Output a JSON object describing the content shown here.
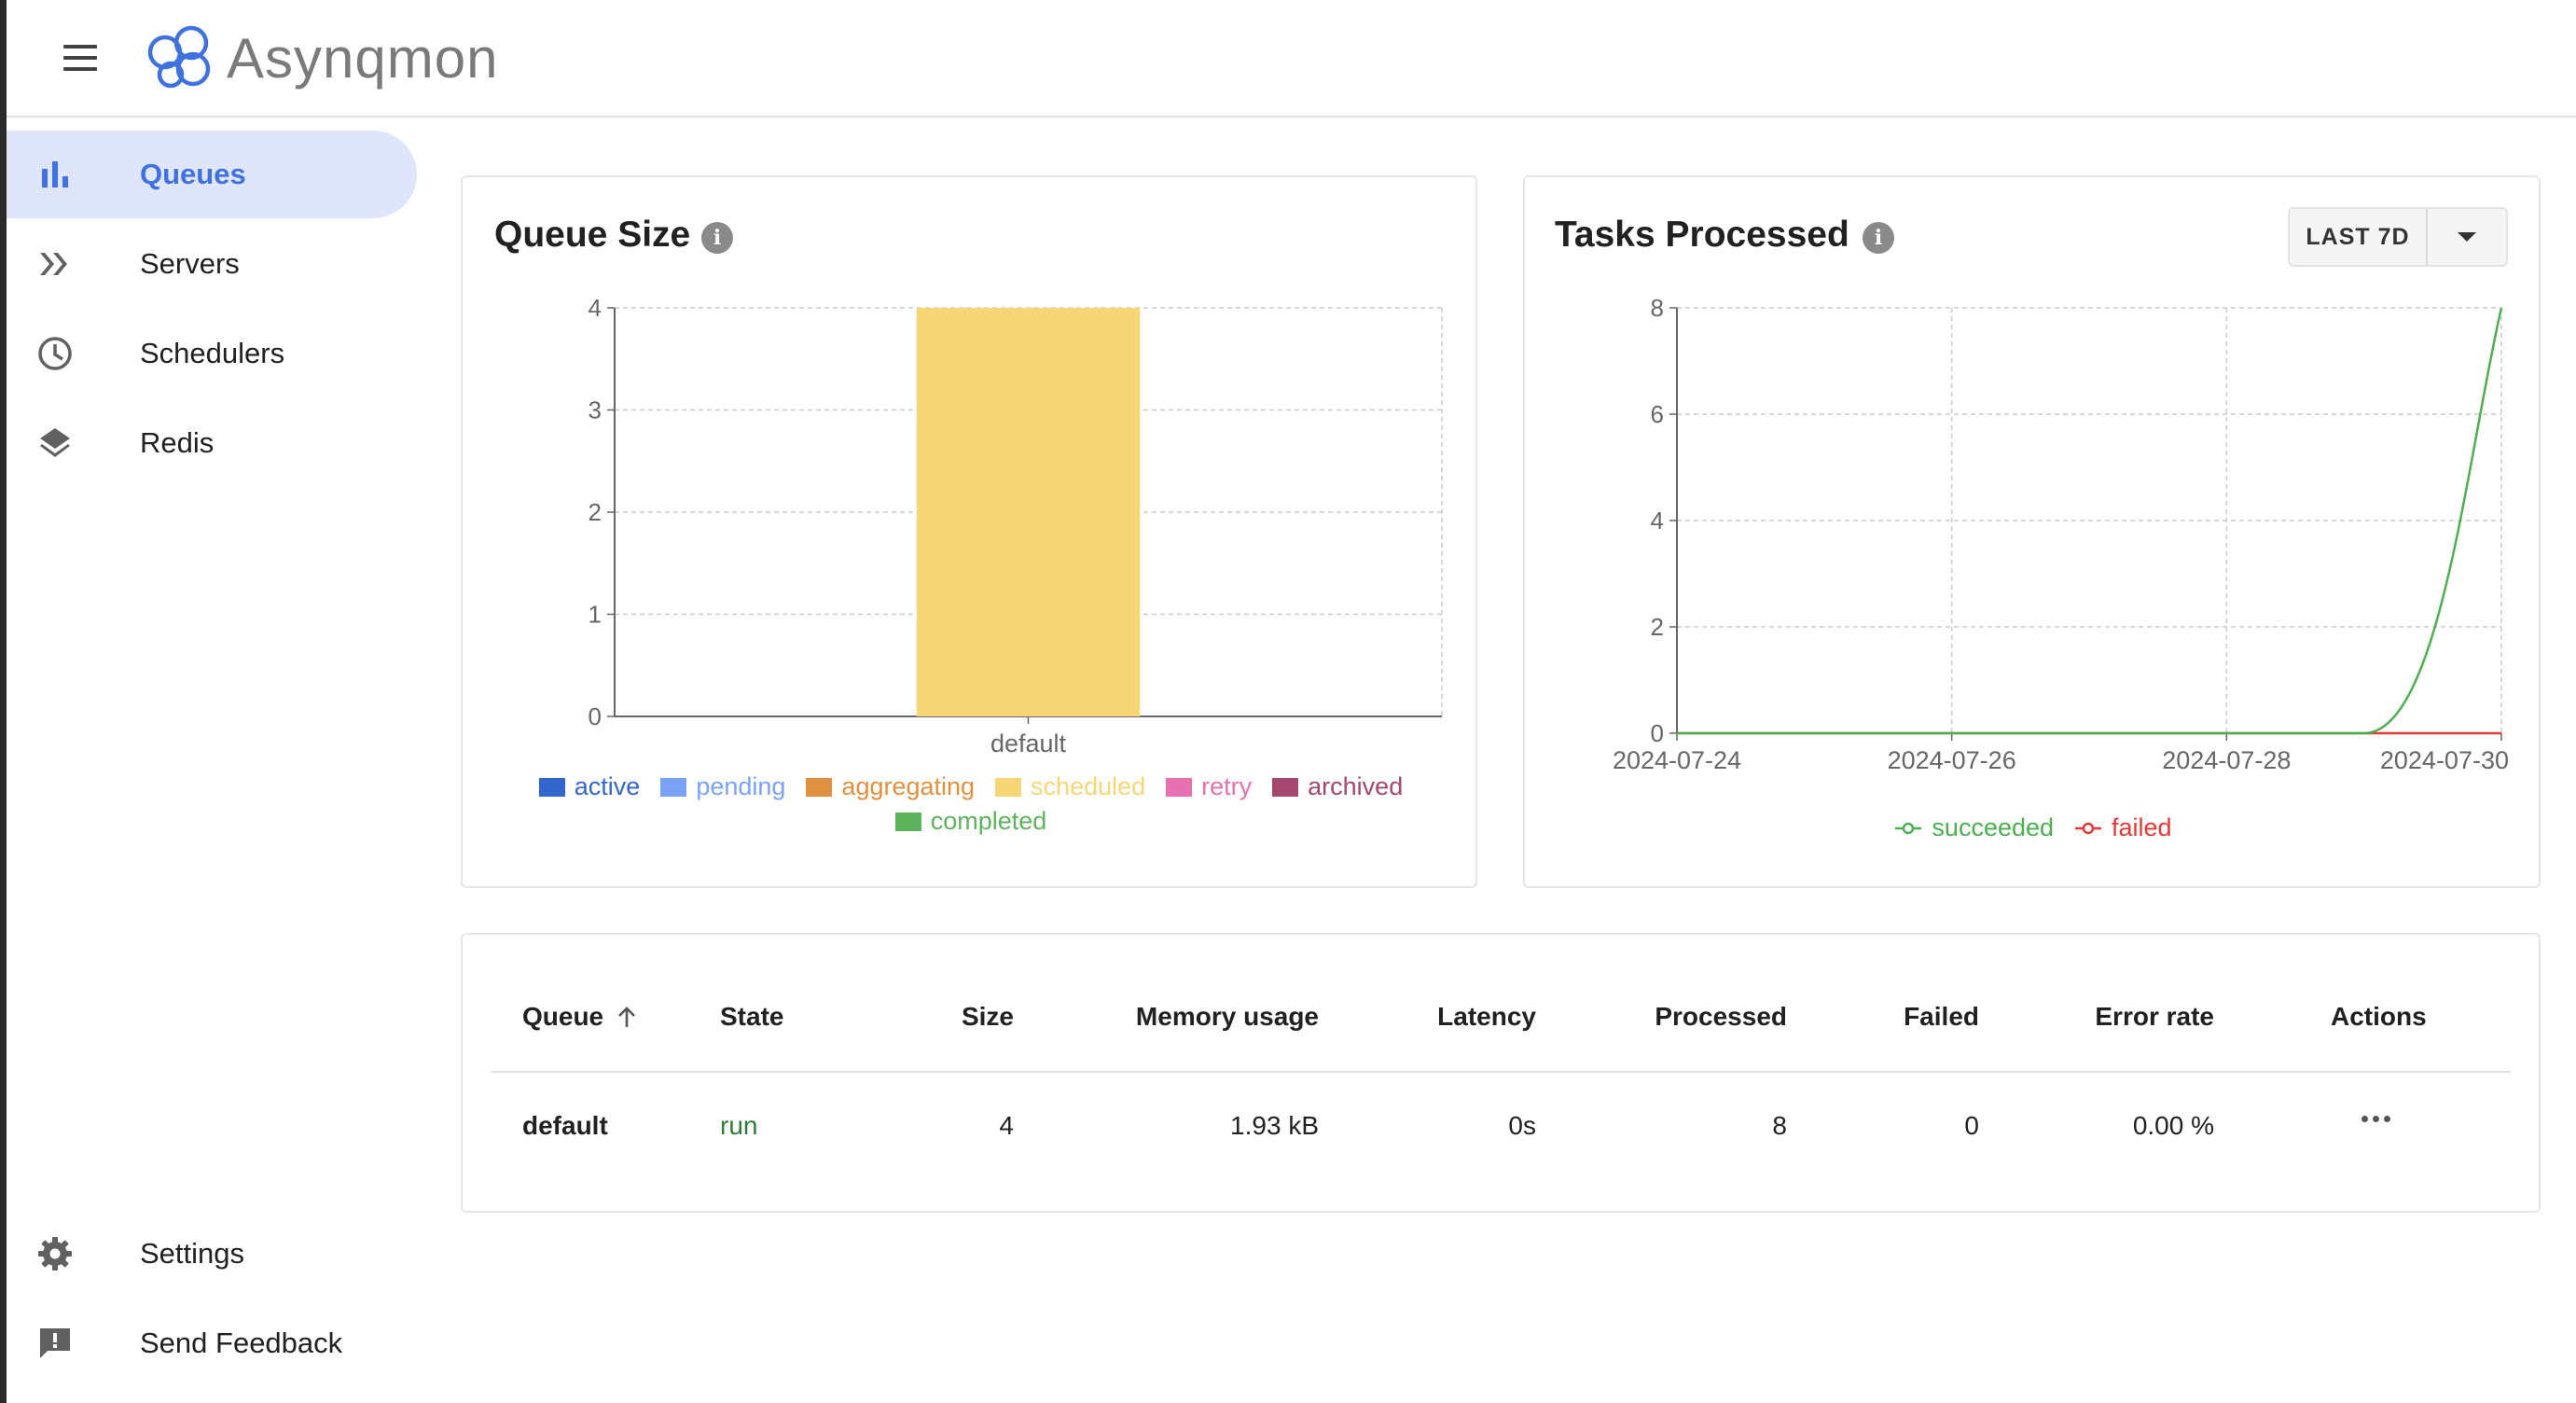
{
  "app": {
    "brand": "Asynqmon"
  },
  "sidebar": {
    "items": [
      {
        "label": "Queues",
        "icon": "bar-chart-icon",
        "active": true
      },
      {
        "label": "Servers",
        "icon": "double-chevron-icon"
      },
      {
        "label": "Schedulers",
        "icon": "clock-icon"
      },
      {
        "label": "Redis",
        "icon": "layers-icon"
      }
    ],
    "bottom_items": [
      {
        "label": "Settings",
        "icon": "gear-icon"
      },
      {
        "label": "Send Feedback",
        "icon": "feedback-icon"
      }
    ]
  },
  "queue_size": {
    "title": "Queue Size",
    "info_glyph": "i",
    "legend": [
      {
        "label": "active",
        "color": "#3366cc"
      },
      {
        "label": "pending",
        "color": "#7aa2f7"
      },
      {
        "label": "aggregating",
        "color": "#e0913f"
      },
      {
        "label": "scheduled",
        "color": "#f6d676"
      },
      {
        "label": "retry",
        "color": "#e86fb0"
      },
      {
        "label": "archived",
        "color": "#a3476e"
      },
      {
        "label": "completed",
        "color": "#5cb35c"
      }
    ]
  },
  "tasks_processed": {
    "title": "Tasks Processed",
    "info_glyph": "i",
    "range_label": "LAST 7D",
    "legend": [
      {
        "label": "succeeded",
        "color": "#4caf50"
      },
      {
        "label": "failed",
        "color": "#e53935"
      }
    ]
  },
  "chart_data": [
    {
      "type": "bar",
      "title": "Queue Size",
      "categories": [
        "default"
      ],
      "stacked": true,
      "series": [
        {
          "name": "active",
          "values": [
            0
          ]
        },
        {
          "name": "pending",
          "values": [
            0
          ]
        },
        {
          "name": "aggregating",
          "values": [
            0
          ]
        },
        {
          "name": "scheduled",
          "values": [
            4
          ]
        },
        {
          "name": "retry",
          "values": [
            0
          ]
        },
        {
          "name": "archived",
          "values": [
            0
          ]
        },
        {
          "name": "completed",
          "values": [
            0
          ]
        }
      ],
      "ylim": [
        0,
        4
      ],
      "yticks": [
        "0",
        "1",
        "2",
        "3",
        "4"
      ],
      "grid": true,
      "legend_position": "bottom"
    },
    {
      "type": "line",
      "title": "Tasks Processed",
      "x": [
        "2024-07-24",
        "2024-07-25",
        "2024-07-26",
        "2024-07-27",
        "2024-07-28",
        "2024-07-29",
        "2024-07-30"
      ],
      "xticks": [
        "2024-07-24",
        "2024-07-26",
        "2024-07-28",
        "2024-07-30"
      ],
      "series": [
        {
          "name": "succeeded",
          "values": [
            0,
            0,
            0,
            0,
            0,
            0,
            8
          ]
        },
        {
          "name": "failed",
          "values": [
            0,
            0,
            0,
            0,
            0,
            0,
            0
          ]
        }
      ],
      "ylim": [
        0,
        8
      ],
      "yticks": [
        "0",
        "2",
        "4",
        "6",
        "8"
      ],
      "grid": true,
      "legend_position": "bottom"
    }
  ],
  "table": {
    "headers": {
      "queue": "Queue",
      "state": "State",
      "size": "Size",
      "memory": "Memory usage",
      "latency": "Latency",
      "processed": "Processed",
      "failed": "Failed",
      "error_rate": "Error rate",
      "actions": "Actions"
    },
    "sort": {
      "column": "queue",
      "direction": "asc"
    },
    "rows": [
      {
        "queue": "default",
        "state": "run",
        "size": "4",
        "memory": "1.93 kB",
        "latency": "0s",
        "processed": "8",
        "failed": "0",
        "error_rate": "0.00 %"
      }
    ]
  }
}
